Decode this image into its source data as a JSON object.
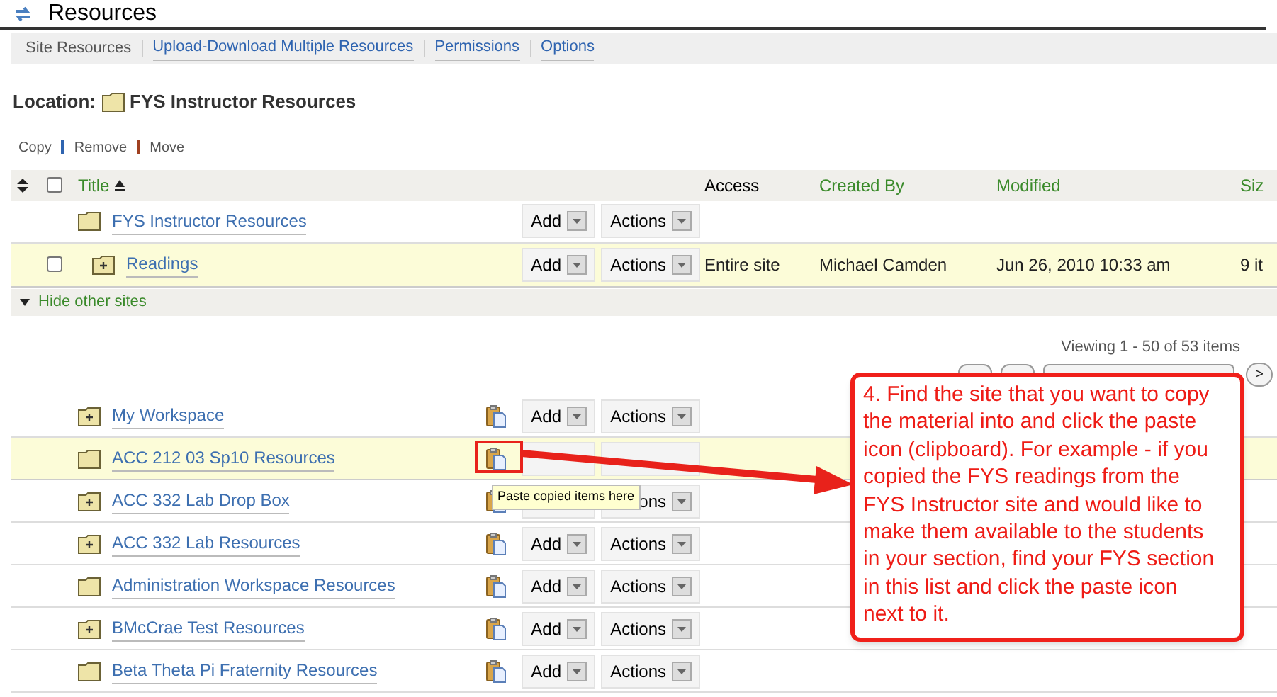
{
  "header": {
    "title": "Resources"
  },
  "nav_tabs": [
    {
      "label": "Site Resources",
      "selected": true
    },
    {
      "label": "Upload-Download Multiple Resources",
      "selected": false
    },
    {
      "label": "Permissions",
      "selected": false
    },
    {
      "label": "Options",
      "selected": false
    }
  ],
  "location": {
    "label": "Location:",
    "folder": "FYS Instructor Resources"
  },
  "toolbar": [
    "Copy",
    "Remove",
    "Move"
  ],
  "table": {
    "select_all": {
      "checked": false
    },
    "columns": [
      {
        "label": "Title",
        "sortable": true,
        "sorted": true
      },
      {
        "label": "Access",
        "sortable": false,
        "sorted": false
      },
      {
        "label": "Created By",
        "sortable": true,
        "sorted": false
      },
      {
        "label": "Modified",
        "sortable": true,
        "sorted": false
      },
      {
        "label": "Siz",
        "sortable": true,
        "sorted": false
      }
    ],
    "rows": [
      {
        "title": "FYS Instructor Resources",
        "has_contents": false,
        "highlighted": false,
        "add": "Add",
        "actions": "Actions",
        "children": [
          {
            "title": "Readings",
            "has_contents": true,
            "highlighted": true,
            "checked": false,
            "add": "Add",
            "actions": "Actions",
            "access": "Entire site",
            "created_by": "Michael Camden",
            "modified": "Jun 26, 2010 10:33 am",
            "size": "9 it"
          }
        ]
      }
    ]
  },
  "hide_other_sites": "Hide other sites",
  "pager": {
    "viewing": "Viewing 1 - 50 of 53 items",
    "next": ">"
  },
  "sites": [
    {
      "title": "My Workspace",
      "has_contents": true,
      "highlighted": false,
      "add": "Add",
      "actions": "Actions"
    },
    {
      "title": "ACC 212 03 Sp10 Resources",
      "has_contents": false,
      "highlighted": true
    },
    {
      "title": "ACC 332 Lab Drop Box",
      "has_contents": true,
      "highlighted": false,
      "actions": "ons"
    },
    {
      "title": "ACC 332 Lab Resources",
      "has_contents": true,
      "highlighted": false,
      "add": "Add",
      "actions": "Actions"
    },
    {
      "title": "Administration Workspace Resources",
      "has_contents": false,
      "highlighted": false,
      "add": "Add",
      "actions": "Actions"
    },
    {
      "title": "BMcCrae Test Resources",
      "has_contents": true,
      "highlighted": false,
      "add": "Add",
      "actions": "Actions"
    },
    {
      "title": "Beta Theta Pi Fraternity Resources",
      "has_contents": false,
      "highlighted": false,
      "add": "Add",
      "actions": "Actions"
    }
  ],
  "tooltip": "Paste copied items here",
  "callout": "4. Find the site that you want to copy the material into and click the paste icon (clipboard).  For example - if you copied the FYS readings from the FYS Instructor site and would like to make them available to the students in your section, find your FYS section in this list and click the paste icon next to it."
}
